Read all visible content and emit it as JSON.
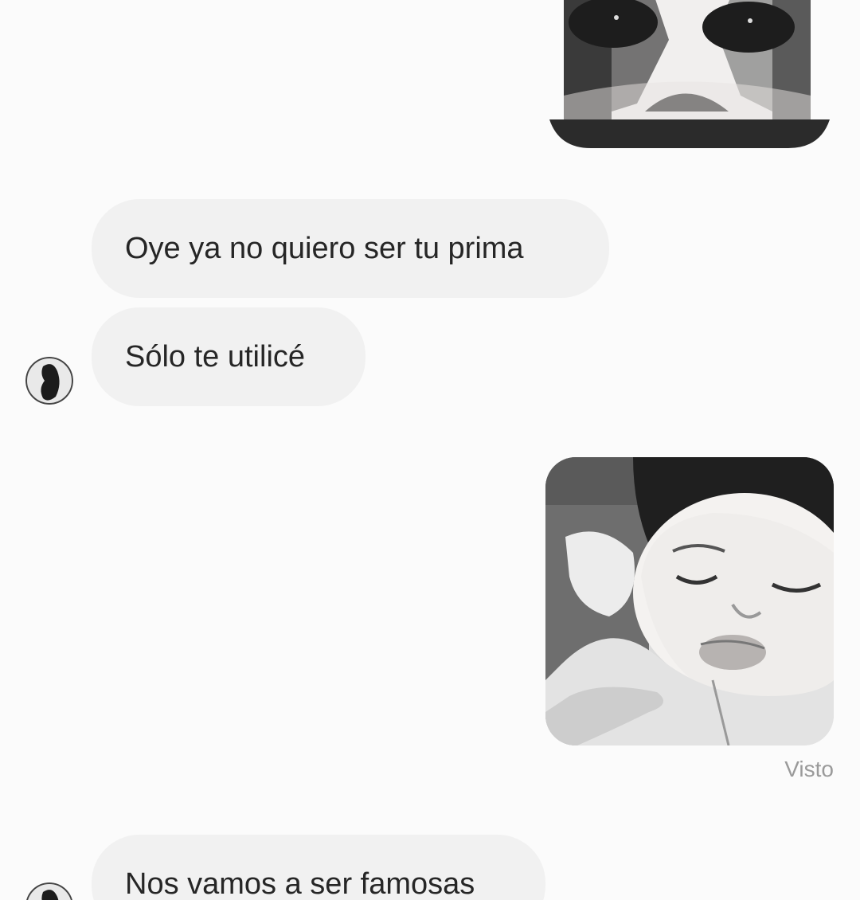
{
  "conversation": {
    "messages": [
      {
        "id": "m1",
        "sender": "me",
        "type": "image",
        "description": "dog-face-photo"
      },
      {
        "id": "m2",
        "sender": "them",
        "type": "text",
        "text": "Oye ya no quiero ser tu prima"
      },
      {
        "id": "m3",
        "sender": "them",
        "type": "text",
        "text": "Sólo te utilicé"
      },
      {
        "id": "m4",
        "sender": "me",
        "type": "image",
        "description": "sad-baby-photo"
      },
      {
        "id": "m5",
        "sender": "them",
        "type": "text",
        "text": "Nos vamos a ser famosas"
      }
    ],
    "seen_label": "Visto"
  },
  "colors": {
    "background": "#fbfbfb",
    "incoming_bubble": "#f1f1f1",
    "text": "#262626",
    "meta_text": "#9a9a9a"
  },
  "icons": {
    "avatar": "contact-avatar-photo"
  }
}
